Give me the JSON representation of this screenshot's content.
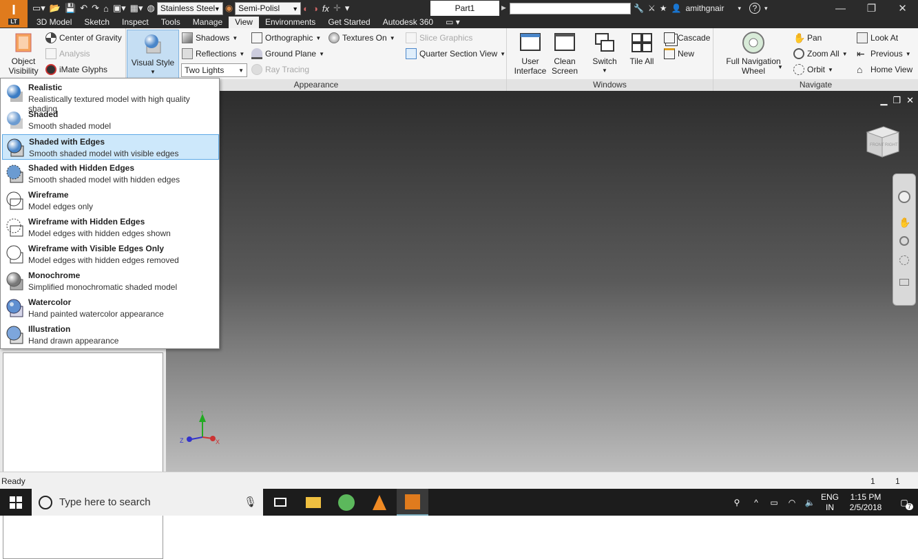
{
  "titlebar": {
    "app_logo_letter": "I",
    "app_logo_badge": "LT",
    "material": "Stainless Steel",
    "appearance": "Semi-Polisl",
    "fx_label": "fx",
    "document": "Part1",
    "user": "amithgnair",
    "help": "?"
  },
  "tabs": [
    "3D Model",
    "Sketch",
    "Inspect",
    "Tools",
    "Manage",
    "View",
    "Environments",
    "Get Started",
    "Autodesk 360"
  ],
  "active_tab": "View",
  "ribbon": {
    "object_visibility": "Object Visibility",
    "center_of_gravity": "Center of Gravity",
    "analysis": "Analysis",
    "imate_glyphs": "iMate Glyphs",
    "visual_style": "Visual Style",
    "shadows": "Shadows",
    "reflections": "Reflections",
    "two_lights": "Two Lights",
    "orthographic": "Orthographic",
    "ground_plane": "Ground Plane",
    "ray_tracing": "Ray Tracing",
    "textures_on": "Textures On",
    "slice_graphics": "Slice Graphics",
    "quarter_section_view": "Quarter Section View",
    "appearance_panel": "Appearance",
    "user_interface": "User Interface",
    "clean_screen": "Clean Screen",
    "switch": "Switch",
    "tile_all": "Tile All",
    "cascade": "Cascade",
    "new": "New",
    "windows_panel": "Windows",
    "full_nav_wheel": "Full Navigation Wheel",
    "pan": "Pan",
    "zoom_all": "Zoom All",
    "orbit": "Orbit",
    "look_at": "Look At",
    "previous": "Previous",
    "home_view": "Home View",
    "navigate_panel": "Navigate"
  },
  "visual_styles": [
    {
      "title": "Realistic",
      "desc": "Realistically textured model with high quality shading",
      "icon": "realistic-sphere-icon"
    },
    {
      "title": "Shaded",
      "desc": "Smooth shaded model",
      "icon": "shaded-sphere-icon"
    },
    {
      "title": "Shaded with Edges",
      "desc": "Smooth shaded model with visible edges",
      "icon": "shaded-edges-icon"
    },
    {
      "title": "Shaded with Hidden Edges",
      "desc": "Smooth shaded model with hidden edges",
      "icon": "shaded-hidden-edges-icon"
    },
    {
      "title": "Wireframe",
      "desc": "Model edges only",
      "icon": "wireframe-icon"
    },
    {
      "title": "Wireframe with Hidden Edges",
      "desc": "Model edges with hidden edges shown",
      "icon": "wireframe-hidden-icon"
    },
    {
      "title": "Wireframe with Visible Edges Only",
      "desc": "Model edges with hidden edges removed",
      "icon": "wireframe-visible-icon"
    },
    {
      "title": "Monochrome",
      "desc": "Simplified monochromatic shaded model",
      "icon": "monochrome-icon"
    },
    {
      "title": "Watercolor",
      "desc": "Hand painted watercolor appearance",
      "icon": "watercolor-icon"
    },
    {
      "title": "Illustration",
      "desc": "Hand drawn appearance",
      "icon": "illustration-icon"
    }
  ],
  "selected_style": "Shaded with Edges",
  "viewcube": {
    "face1": "FRONT",
    "face2": "RIGHT"
  },
  "axes": {
    "y": "Y",
    "z": "Z",
    "x": "X"
  },
  "status": {
    "text": "Ready",
    "num1": "1",
    "num2": "1"
  },
  "taskbar": {
    "search_placeholder": "Type here to search",
    "lang1": "ENG",
    "lang2": "IN",
    "time": "1:15 PM",
    "date": "2/5/2018",
    "notif_count": "7"
  },
  "colors": {
    "accent": "#e07b1d",
    "selected_bg": "#cde8fb",
    "selected_border": "#5aa8e6"
  }
}
